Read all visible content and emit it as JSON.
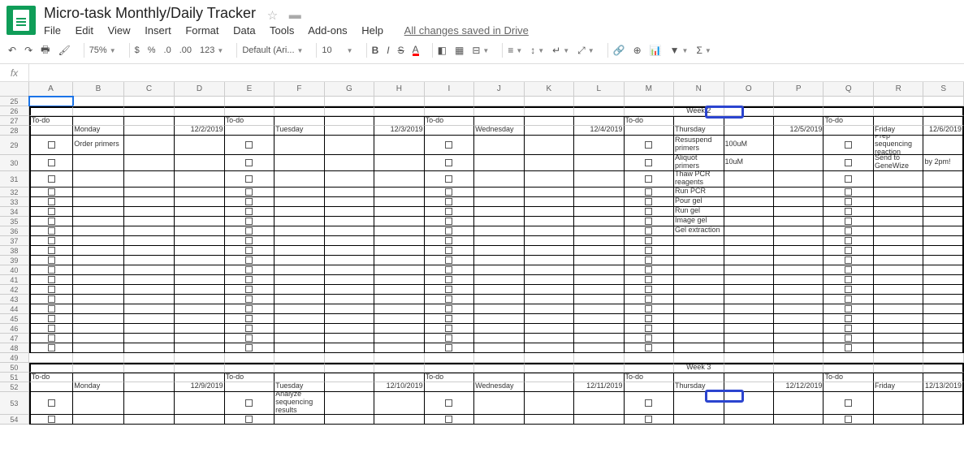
{
  "doc_title": "Micro-task Monthly/Daily Tracker",
  "menus": [
    "File",
    "Edit",
    "View",
    "Insert",
    "Format",
    "Data",
    "Tools",
    "Add-ons",
    "Help"
  ],
  "save_status": "All changes saved in Drive",
  "toolbar": {
    "zoom": "75%",
    "font": "Default (Ari...",
    "font_size": "10",
    "currency": "$",
    "percent": "%",
    "dec_dec": ".0",
    "dec_inc": ".00",
    "num_fmt": "123"
  },
  "fx": "fx",
  "columns": [
    "A",
    "B",
    "C",
    "D",
    "E",
    "F",
    "G",
    "H",
    "I",
    "J",
    "K",
    "L",
    "M",
    "N",
    "O",
    "P",
    "Q",
    "R",
    "S"
  ],
  "row_numbers": [
    25,
    26,
    27,
    28,
    29,
    30,
    31,
    32,
    33,
    34,
    35,
    36,
    37,
    38,
    39,
    40,
    41,
    42,
    43,
    44,
    45,
    46,
    47,
    48,
    49,
    50,
    51,
    52,
    53,
    54
  ],
  "week2": {
    "label": "Week 2",
    "todo": "To-do",
    "days": [
      {
        "name": "Monday",
        "date": "12/2/2019"
      },
      {
        "name": "Tuesday",
        "date": "12/3/2019"
      },
      {
        "name": "Wednesday",
        "date": "12/4/2019"
      },
      {
        "name": "Thursday",
        "date": "12/5/2019"
      },
      {
        "name": "Friday",
        "date": "12/6/2019"
      }
    ],
    "monday": [
      "Order primers"
    ],
    "thursday": [
      "Resuspend primers",
      "Aliquot primers",
      "Thaw PCR reagents",
      "Run PCR",
      "Pour gel",
      "Run gel",
      "Image gel",
      "Gel extraction"
    ],
    "thursday_extra": [
      "100uM",
      "10uM"
    ],
    "friday": [
      "Prep sequencing reaction",
      "Send to GeneWize"
    ],
    "friday_extra": [
      "by 2pm!"
    ]
  },
  "week3": {
    "label": "Week 3",
    "todo": "To-do",
    "days": [
      {
        "name": "Monday",
        "date": "12/9/2019"
      },
      {
        "name": "Tuesday",
        "date": "12/10/2019"
      },
      {
        "name": "Wednesday",
        "date": "12/11/2019"
      },
      {
        "name": "Thursday",
        "date": "12/12/2019"
      },
      {
        "name": "Friday",
        "date": "12/13/2019"
      }
    ],
    "tuesday": [
      "Analyze sequencing results"
    ]
  }
}
